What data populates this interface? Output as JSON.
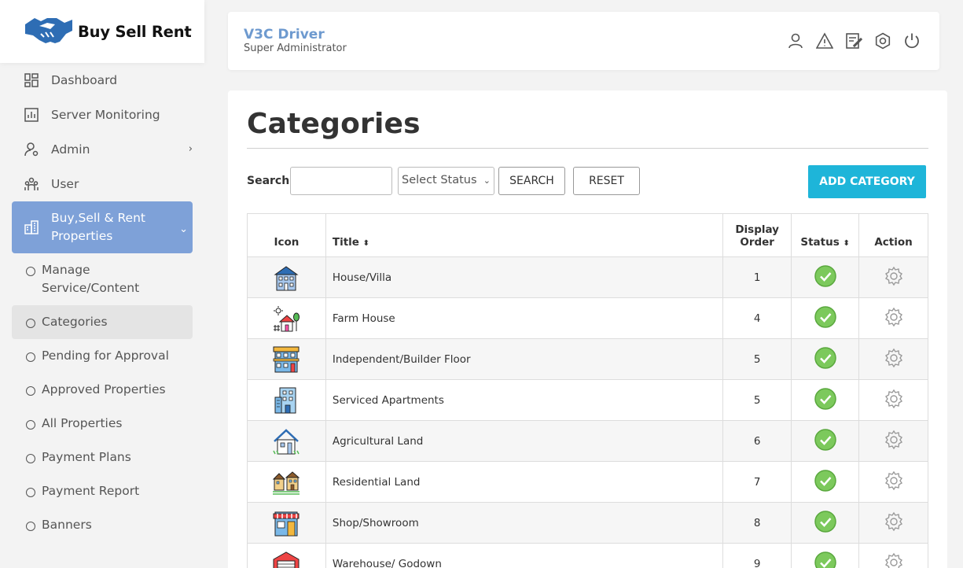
{
  "brand": {
    "name": "Buy Sell Rent"
  },
  "header": {
    "user_name": "V3C Driver",
    "user_role": "Super Administrator"
  },
  "sidebar": {
    "items": [
      {
        "label": "Dashboard",
        "icon": "dashboard-icon"
      },
      {
        "label": "Server Monitoring",
        "icon": "chart-icon"
      },
      {
        "label": "Admin",
        "icon": "admin-icon"
      },
      {
        "label": "User",
        "icon": "users-icon"
      },
      {
        "label": "Buy,Sell & Rent Properties",
        "icon": "building-icon"
      }
    ],
    "subitems": [
      {
        "label": "Manage Service/Content"
      },
      {
        "label": "Categories"
      },
      {
        "label": "Pending for Approval"
      },
      {
        "label": "Approved Properties"
      },
      {
        "label": "All Properties"
      },
      {
        "label": "Payment Plans"
      },
      {
        "label": "Payment Report"
      },
      {
        "label": "Banners"
      }
    ]
  },
  "page": {
    "title": "Categories",
    "search_label": "Search:",
    "search_value": "",
    "status_select": "Select Status",
    "search_button": "SEARCH",
    "reset_button": "RESET",
    "add_button": "ADD CATEGORY"
  },
  "table": {
    "headers": {
      "icon": "Icon",
      "title": "Title",
      "order_line1": "Display",
      "order_line2": "Order",
      "status": "Status",
      "action": "Action"
    },
    "rows": [
      {
        "title": "House/Villa",
        "order": "1"
      },
      {
        "title": "Farm House",
        "order": "4"
      },
      {
        "title": "Independent/Builder Floor",
        "order": "5"
      },
      {
        "title": "Serviced Apartments",
        "order": "5"
      },
      {
        "title": "Agricultural Land",
        "order": "6"
      },
      {
        "title": "Residential Land",
        "order": "7"
      },
      {
        "title": "Shop/Showroom",
        "order": "8"
      },
      {
        "title": "Warehouse/ Godown",
        "order": "9"
      }
    ]
  },
  "colors": {
    "accent": "#1eb5d9",
    "sidebar_active": "#7ea1d8",
    "brand_blue": "#2e6db4",
    "status_green": "#7cc95c"
  }
}
